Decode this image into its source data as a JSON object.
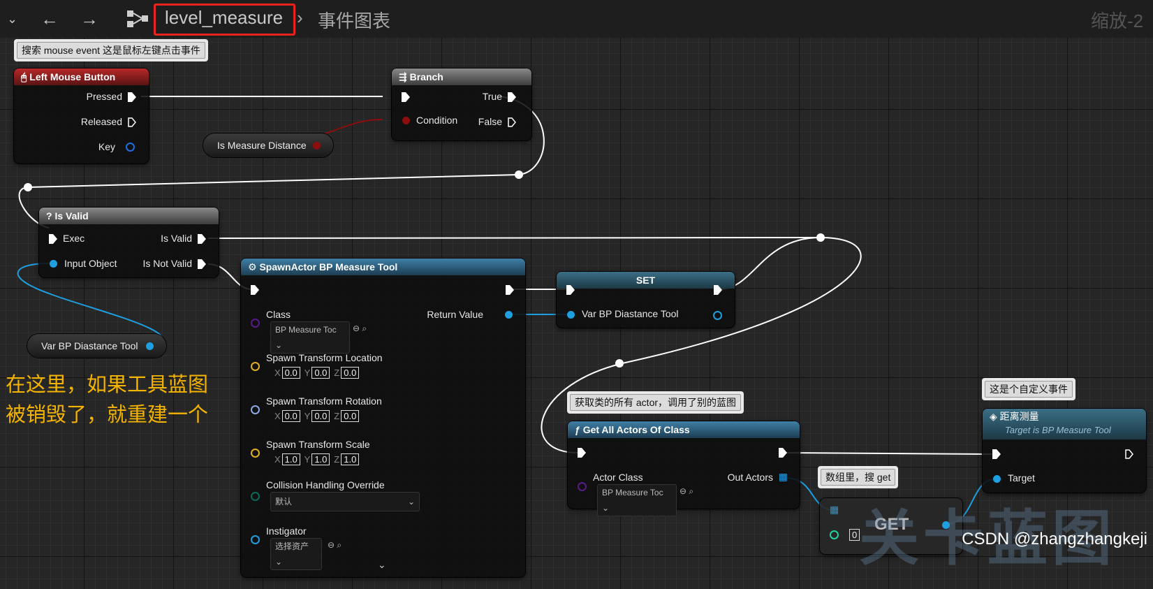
{
  "toolbar": {
    "breadcrumb_asset": "level_measure",
    "breadcrumb_graph": "事件图表",
    "zoom": "缩放-2"
  },
  "comments": {
    "left_mouse": "搜索 mouse event 这是鼠标左键点击事件",
    "get_all": "获取类的所有 actor，调用了别的蓝图",
    "array_get": "数组里，搜 get",
    "custom_event": "这是个自定义事件"
  },
  "nodes": {
    "left_mouse": {
      "title": "Left Mouse Button",
      "pressed": "Pressed",
      "released": "Released",
      "key": "Key"
    },
    "branch": {
      "title": "Branch",
      "condition": "Condition",
      "true": "True",
      "false": "False"
    },
    "is_measure": {
      "label": "Is Measure Distance"
    },
    "is_valid": {
      "title": "Is Valid",
      "exec": "Exec",
      "input_object": "Input Object",
      "is_valid": "Is Valid",
      "is_not_valid": "Is Not Valid"
    },
    "var_tool": {
      "label": "Var BP Diastance Tool"
    },
    "spawn": {
      "title": "SpawnActor BP Measure Tool",
      "class_label": "Class",
      "class_value": "BP Measure Toc",
      "return_value": "Return Value",
      "loc_label": "Spawn Transform Location",
      "loc": [
        "0.0",
        "0.0",
        "0.0"
      ],
      "rot_label": "Spawn Transform Rotation",
      "rot": [
        "0.0",
        "0.0",
        "0.0"
      ],
      "scale_label": "Spawn Transform Scale",
      "scale": [
        "1.0",
        "1.0",
        "1.0"
      ],
      "collision_label": "Collision Handling Override",
      "collision_value": "默认",
      "instigator_label": "Instigator",
      "instigator_value": "选择资产",
      "axes": [
        "X",
        "Y",
        "Z"
      ]
    },
    "set": {
      "title": "SET",
      "var": "Var BP Diastance Tool"
    },
    "get_all": {
      "title": "Get All Actors Of Class",
      "actor_class": "Actor Class",
      "class_value": "BP Measure Toc",
      "out_actors": "Out Actors"
    },
    "get": {
      "title": "GET",
      "index": "0"
    },
    "custom": {
      "title": "距离测量",
      "subtitle": "Target is BP Measure Tool",
      "target": "Target"
    }
  },
  "annotation": {
    "line1": "在这里，如果工具蓝图",
    "line2": "被销毁了，就重建一个"
  },
  "watermark": {
    "text": "关卡蓝图",
    "credit": "CSDN @zhangzhangkeji"
  },
  "colors": {
    "exec": "#ffffff",
    "object": "#1e9fe0",
    "bool": "#8c0e0e",
    "class": "#5a1a8a",
    "vector": "#e0b020",
    "rotator": "#8fa8e8",
    "enum": "#0a6a5a",
    "int": "#1ed6a0",
    "highlight": "#e8231c",
    "annotation": "#f5b400"
  }
}
